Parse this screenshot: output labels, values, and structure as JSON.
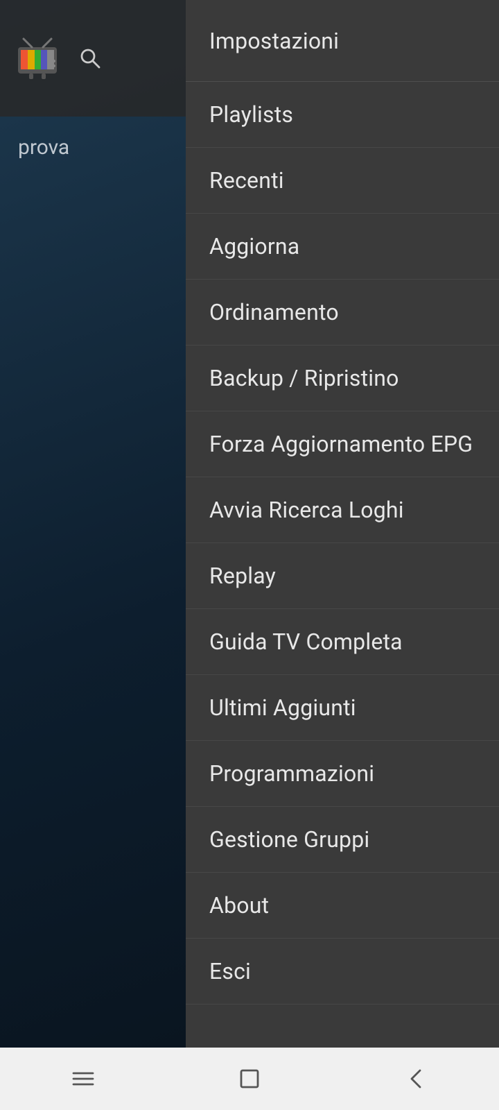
{
  "header": {
    "logo_alt": "TV logo",
    "search_icon": "search-icon",
    "user_label": "prova"
  },
  "menu": {
    "items": [
      {
        "id": "impostazioni",
        "label": "Impostazioni"
      },
      {
        "id": "playlists",
        "label": "Playlists"
      },
      {
        "id": "recenti",
        "label": "Recenti"
      },
      {
        "id": "aggiorna",
        "label": "Aggiorna"
      },
      {
        "id": "ordinamento",
        "label": "Ordinamento"
      },
      {
        "id": "backup-ripristino",
        "label": "Backup / Ripristino"
      },
      {
        "id": "forza-aggiornamento-epg",
        "label": "Forza Aggiornamento EPG"
      },
      {
        "id": "avvia-ricerca-loghi",
        "label": "Avvia Ricerca Loghi"
      },
      {
        "id": "replay",
        "label": "Replay"
      },
      {
        "id": "guida-tv-completa",
        "label": "Guida TV Completa"
      },
      {
        "id": "ultimi-aggiunti",
        "label": "Ultimi Aggiunti"
      },
      {
        "id": "programmazioni",
        "label": "Programmazioni"
      },
      {
        "id": "gestione-gruppi",
        "label": "Gestione Gruppi"
      },
      {
        "id": "about",
        "label": "About"
      },
      {
        "id": "esci",
        "label": "Esci"
      }
    ]
  },
  "navbar": {
    "menu_icon": "hamburger-icon",
    "home_icon": "square-icon",
    "back_icon": "back-icon"
  }
}
